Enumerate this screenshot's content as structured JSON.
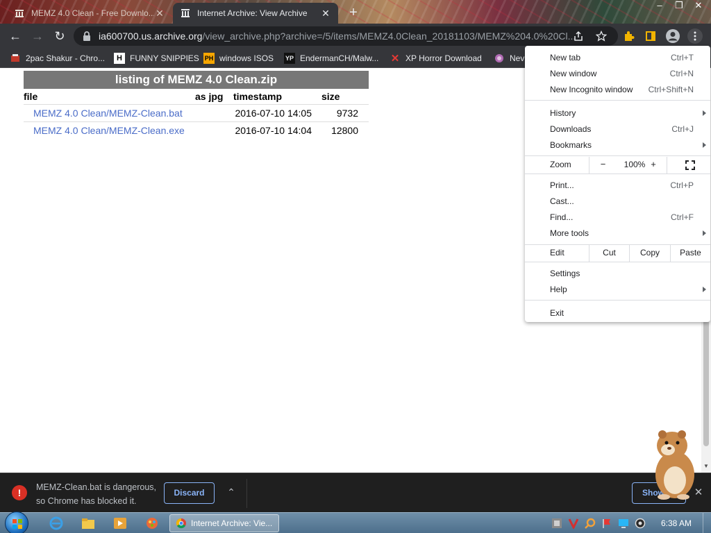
{
  "tabs": [
    {
      "label": "MEMZ 4.0 Clean - Free Downlo...",
      "active": false
    },
    {
      "label": "Internet Archive: View Archive",
      "active": true
    }
  ],
  "address": {
    "host": "ia600700.us.archive.org",
    "path": "/view_archive.php?archive=/5/items/MEMZ4.0Clean_20181103/MEMZ%204.0%20Cl..."
  },
  "bookmarks": [
    {
      "label": "2pac Shakur - Chro...",
      "icon": "bookmark-favicon"
    },
    {
      "label": "FUNNY SNIPPIES",
      "icon": "h-letter-icon"
    },
    {
      "label": "windows ISOS",
      "icon": "ph-icon"
    },
    {
      "label": "EndermanCH/Malw...",
      "icon": "yp-icon"
    },
    {
      "label": "XP Horror Download",
      "icon": "red-x-icon"
    },
    {
      "label": "Nev",
      "icon": "globe-icon"
    }
  ],
  "listing": {
    "title": "listing of MEMZ 4.0 Clean.zip",
    "headers": {
      "file": "file",
      "as_jpg": "as jpg",
      "timestamp": "timestamp",
      "size": "size"
    },
    "rows": [
      {
        "file": "MEMZ 4.0 Clean/MEMZ-Clean.bat",
        "timestamp": "2016-07-10 14:05",
        "size": "9732"
      },
      {
        "file": "MEMZ 4.0 Clean/MEMZ-Clean.exe",
        "timestamp": "2016-07-10 14:04",
        "size": "12800"
      }
    ]
  },
  "menu": {
    "new_tab": "New tab",
    "new_tab_sc": "Ctrl+T",
    "new_window": "New window",
    "new_window_sc": "Ctrl+N",
    "incognito": "New Incognito window",
    "incognito_sc": "Ctrl+Shift+N",
    "history": "History",
    "downloads": "Downloads",
    "downloads_sc": "Ctrl+J",
    "bookmarks": "Bookmarks",
    "zoom": "Zoom",
    "zoom_minus": "−",
    "zoom_value": "100%",
    "zoom_plus": "+",
    "print": "Print...",
    "print_sc": "Ctrl+P",
    "cast": "Cast...",
    "find": "Find...",
    "find_sc": "Ctrl+F",
    "more_tools": "More tools",
    "edit": "Edit",
    "cut": "Cut",
    "copy": "Copy",
    "paste": "Paste",
    "settings": "Settings",
    "help": "Help",
    "exit": "Exit"
  },
  "download_bar": {
    "warning": "MEMZ-Clean.bat is dangerous, so Chrome has blocked it.",
    "discard": "Discard",
    "show_all": "Show all"
  },
  "taskbar": {
    "window_label": "Internet Archive: Vie...",
    "clock": "6:38 AM"
  },
  "colors": {
    "chrome_dark": "#35363a",
    "link": "#4a6cc8",
    "listing_header": "#777777",
    "accent_blue": "#8ab4f8",
    "danger": "#d93025"
  }
}
